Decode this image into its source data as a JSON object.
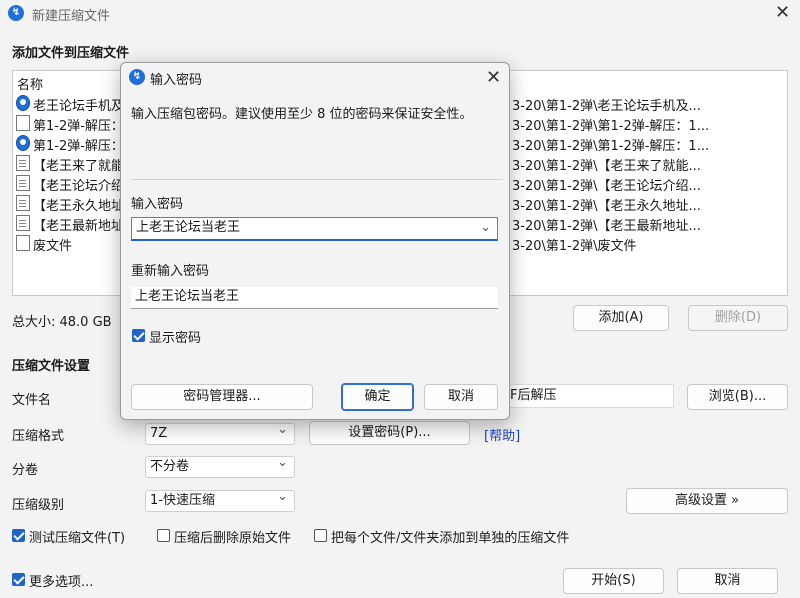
{
  "window": {
    "title": "新建压缩文件",
    "app_icon": "archive-app-icon"
  },
  "add_section": {
    "heading": "添加文件到压缩文件",
    "column_name": "名称",
    "files": [
      {
        "icon": "app",
        "name": "老王论坛手机及",
        "path": "3-20\\第1-2弹\\老王论坛手机及..."
      },
      {
        "icon": "blank",
        "name": "第1-2弹-解压：",
        "path": "3-20\\第1-2弹\\第1-2弹-解压：1..."
      },
      {
        "icon": "app",
        "name": "第1-2弹-解压：",
        "path": "3-20\\第1-2弹\\第1-2弹-解压：1..."
      },
      {
        "icon": "doc",
        "name": "【老王来了就能",
        "path": "3-20\\第1-2弹\\【老王来了就能..."
      },
      {
        "icon": "doc",
        "name": "【老王论坛介绍",
        "path": "3-20\\第1-2弹\\【老王论坛介绍..."
      },
      {
        "icon": "doc",
        "name": "【老王永久地址",
        "path": "3-20\\第1-2弹\\【老王永久地址..."
      },
      {
        "icon": "doc",
        "name": "【老王最新地址",
        "path": "3-20\\第1-2弹\\【老王最新地址..."
      },
      {
        "icon": "blank",
        "name": "废文件",
        "path": "3-20\\第1-2弹\\废文件"
      }
    ],
    "total_size": "总大小: 48.0 GB",
    "add_button": "添加(A)",
    "delete_button": "删除(D)"
  },
  "settings": {
    "heading": "压缩文件设置",
    "filename_label": "文件名",
    "filename_value": "F后解压",
    "browse_button": "浏览(B)...",
    "format_label": "压缩格式",
    "format_value": "7Z",
    "set_password_button": "设置密码(P)...",
    "help_link": "[帮助]",
    "volume_label": "分卷",
    "volume_value": "不分卷",
    "level_label": "压缩级别",
    "level_value": "1-快速压缩",
    "advanced_button": "高级设置 »",
    "test_label": "测试压缩文件(T)",
    "delete_after_label": "压缩后删除原始文件",
    "separate_label": "把每个文件/文件夹添加到单独的压缩文件",
    "more_options_label": "更多选项...",
    "start_button": "开始(S)",
    "cancel_button": "取消"
  },
  "dialog": {
    "title": "输入密码",
    "hint": "输入压缩包密码。建议使用至少 8 位的密码来保证安全性。",
    "password_label": "输入密码",
    "password_value": "上老王论坛当老王",
    "confirm_label": "重新输入密码",
    "confirm_value": "上老王论坛当老王",
    "show_password_label": "显示密码",
    "manager_button": "密码管理器...",
    "ok_button": "确定",
    "cancel_button": "取消"
  },
  "colors": {
    "accent": "#2163c6",
    "link": "#1a46c8"
  }
}
